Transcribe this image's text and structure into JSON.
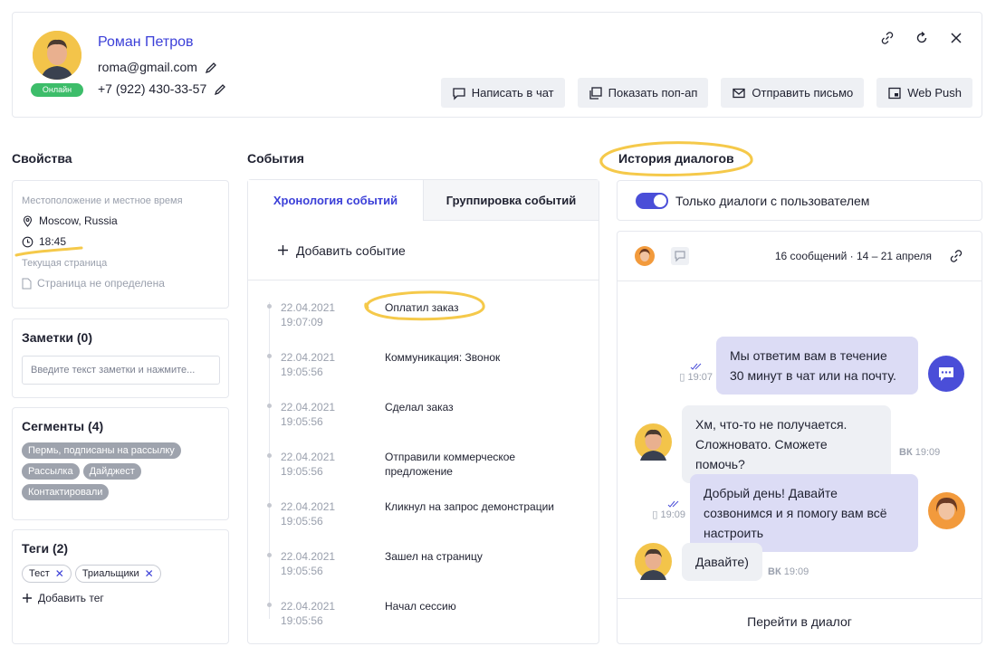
{
  "profile": {
    "name": "Роман Петров",
    "email": "roma@gmail.com",
    "phone": "+7 (922) 430-33-57",
    "status": "Онлайн"
  },
  "header_icons": [
    "link-icon",
    "refresh-icon",
    "close-icon"
  ],
  "actions": [
    {
      "label": "Написать в чат",
      "icon": "chat-icon"
    },
    {
      "label": "Показать поп-ап",
      "icon": "popup-icon"
    },
    {
      "label": "Отправить письмо",
      "icon": "mail-icon"
    },
    {
      "label": "Web Push",
      "icon": "push-icon"
    }
  ],
  "sections": {
    "properties": "Свойства",
    "events": "События",
    "history": "История диалогов"
  },
  "location": {
    "title": "Местоположение и местное время",
    "city": "Moscow, Russia",
    "time": "18:45",
    "page_title": "Текущая страница",
    "page_value": "Страница не определена"
  },
  "notes": {
    "title": "Заметки (0)",
    "placeholder": "Введите текст заметки и нажмите..."
  },
  "segments": {
    "title": "Сегменты (4)",
    "items": [
      "Пермь, подписаны на рассылку",
      "Рассылка",
      "Дайджест",
      "Контактировали"
    ]
  },
  "tags": {
    "title": "Теги (2)",
    "items": [
      "Тест",
      "Триальщики"
    ],
    "add_label": "Добавить тег"
  },
  "events": {
    "tabs": [
      "Хронология событий",
      "Группировка событий"
    ],
    "add_label": "Добавить событие",
    "items": [
      {
        "date": "22.04.2021",
        "time": "19:07:09",
        "text": "Оплатил заказ"
      },
      {
        "date": "22.04.2021",
        "time": "19:05:56",
        "text": "Коммуникация: Звонок"
      },
      {
        "date": "22.04.2021",
        "time": "19:05:56",
        "text": "Сделал заказ"
      },
      {
        "date": "22.04.2021",
        "time": "19:05:56",
        "text": "Отправили коммерческое предложение"
      },
      {
        "date": "22.04.2021",
        "time": "19:05:56",
        "text": "Кликнул на запрос демонстрации"
      },
      {
        "date": "22.04.2021",
        "time": "19:05:56",
        "text": "Зашел на страницу"
      },
      {
        "date": "22.04.2021",
        "time": "19:05:56",
        "text": "Начал сессию"
      }
    ]
  },
  "dialogs": {
    "toggle_label": "Только диалоги с пользователем",
    "meta": "16 сообщений · 14 – 21 апреля",
    "messages": [
      {
        "from": "operator",
        "text": "Мы ответим вам в течение 30 минут в чат или на почту.",
        "time": "19:07"
      },
      {
        "from": "user",
        "text": "Хм, что-то не получается. Сложновато. Сможете помочь?",
        "time": "19:09"
      },
      {
        "from": "operator",
        "text": "Добрый день! Давайте созвонимся и я помогу вам всё настроить",
        "time": "19:09"
      },
      {
        "from": "user",
        "text": "Давайте)",
        "time": "19:09"
      }
    ],
    "goto_label": "Перейти в диалог"
  },
  "colors": {
    "accent": "#3b3fd8",
    "online": "#3dbd6a",
    "highlight": "#f5c94a",
    "operator_bubble": "#dcdcf5"
  }
}
